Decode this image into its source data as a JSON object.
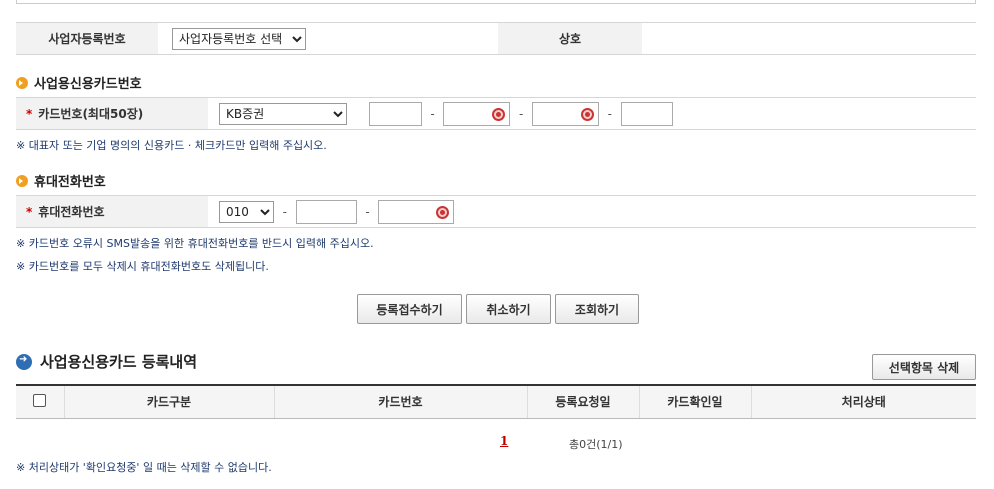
{
  "business": {
    "reg_label": "사업자등록번호",
    "reg_select": "사업자등록번호 선택",
    "name_label": "상호",
    "name_value": ""
  },
  "card_section": {
    "title": "사업용신용카드번호",
    "label": "카드번호(최대50장)",
    "required_mark": "*",
    "company": "KB증권",
    "dash": "-",
    "notice": "※ 대표자 또는 기업 명의의 신용카드 · 체크카드만 입력해 주십시오."
  },
  "phone_section": {
    "title": "휴대전화번호",
    "label": "휴대전화번호",
    "required_mark": "*",
    "prefix": "010",
    "dash": "-",
    "notice1": "※ 카드번호 오류시 SMS발송을 위한 휴대전화번호를 반드시 입력해 주십시오.",
    "notice2": "※ 카드번호를 모두 삭제시 휴대전화번호도 삭제됩니다."
  },
  "buttons": {
    "register": "등록접수하기",
    "cancel": "취소하기",
    "search": "조회하기",
    "delete_selected": "선택항목 삭제"
  },
  "list": {
    "title": "사업용신용카드 등록내역",
    "columns": [
      "카드구분",
      "카드번호",
      "등록요청일",
      "카드확인일",
      "처리상태"
    ],
    "page": "1",
    "total": "총0건(1/1)",
    "notice": "※ 처리상태가 '확인요청중' 일 때는 삭제할 수 없습니다."
  }
}
